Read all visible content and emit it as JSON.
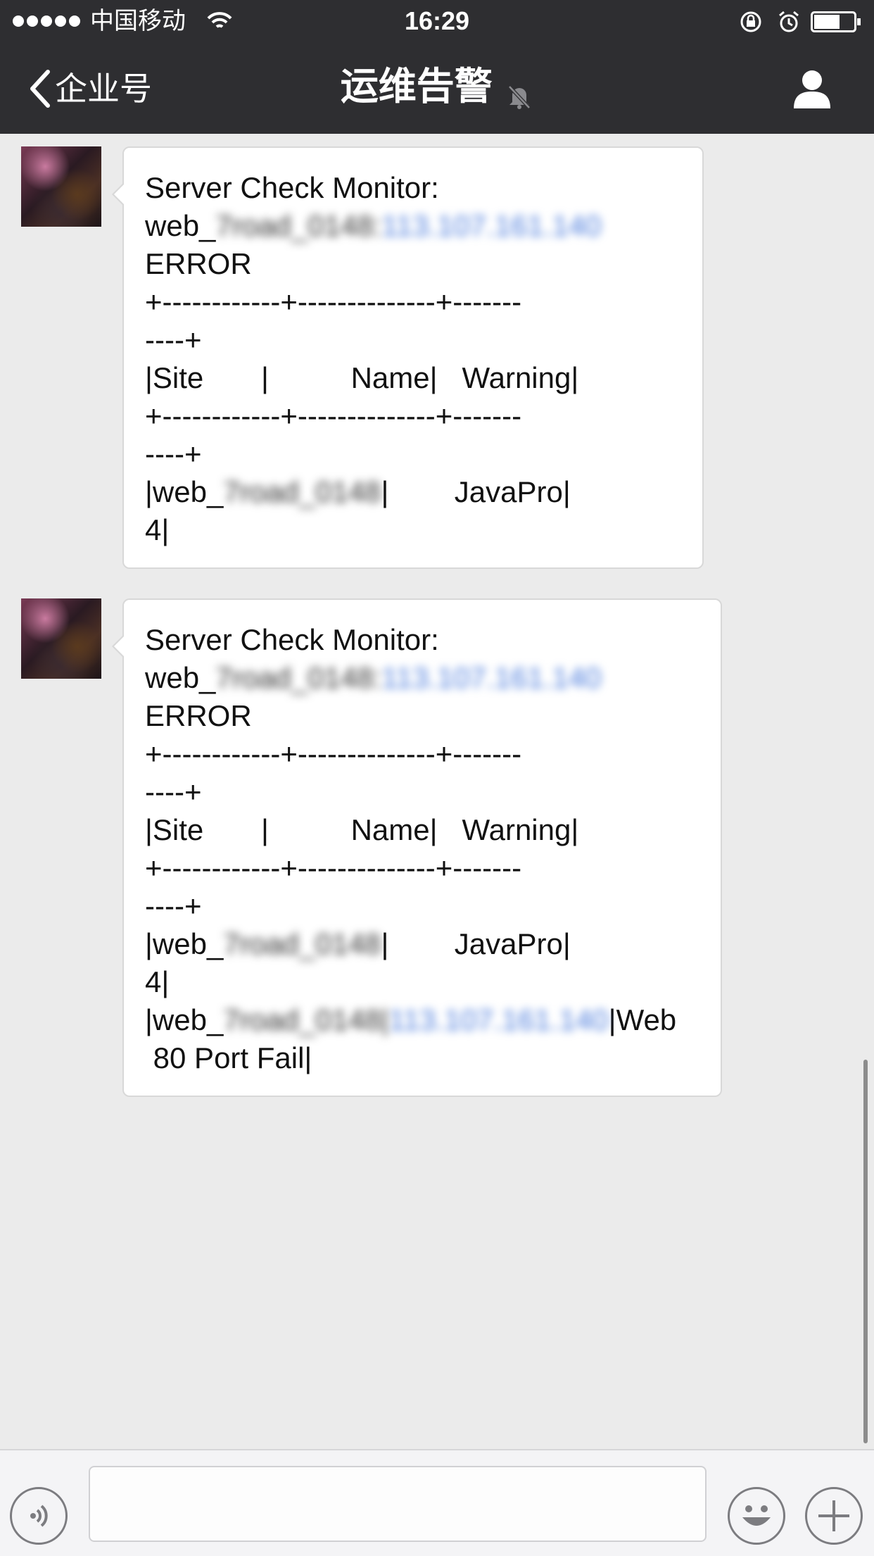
{
  "status_bar": {
    "carrier": "中国移动",
    "time": "16:29"
  },
  "nav": {
    "back_label": "企业号",
    "title": "运维告警"
  },
  "messages": [
    {
      "lines": {
        "l1": "Server Check Monitor:",
        "l2_prefix": "web_",
        "l2_blur_name": "7road_0148:",
        "l2_blur_ip": "113.107.161.140",
        "l3": "ERROR",
        "l4": "+------------+--------------+-------",
        "l5": "----+",
        "l6": "|Site       |          Name|   Warning|",
        "l7": "+------------+--------------+-------",
        "l8": "----+",
        "l9_prefix": "|web_",
        "l9_blur_name": "7road_0148",
        "l9_suffix": "|        JavaPro|",
        "l10": "4|"
      }
    },
    {
      "lines": {
        "l1": "Server Check Monitor:",
        "l2_prefix": "web_",
        "l2_blur_name": "7road_0148:",
        "l2_blur_ip": "113.107.161.140",
        "l3": "ERROR",
        "l4": "+------------+--------------+-------",
        "l5": "----+",
        "l6": "|Site       |          Name|   Warning|",
        "l7": "+------------+--------------+-------",
        "l8": "----+",
        "l9_prefix": "|web_",
        "l9_blur_name": "7road_0148",
        "l9_suffix": "|        JavaPro|",
        "l10": "4|",
        "l11_prefix": "|web_",
        "l11_name": "7road_0148|",
        "l11_blur_ip": "113.107.161.140",
        "l11_suffix": "|Web",
        "l12": " 80 Port Fail|"
      }
    }
  ],
  "icons": {
    "back": "chevron-left-icon",
    "mute": "bell-muted-icon",
    "user": "person-icon",
    "voice": "voice-icon",
    "emoji": "smiley-icon",
    "plus": "plus-icon"
  }
}
